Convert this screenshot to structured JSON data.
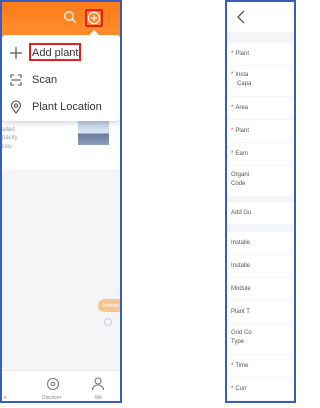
{
  "screen1": {
    "menu": {
      "add_plant": "Add plant",
      "scan": "Scan",
      "plant_location": "Plant Location"
    },
    "card": {
      "line1": "alled",
      "line2": "pacity",
      "line3": "kWp"
    },
    "fab_label": "Monitor",
    "tabs": [
      {
        "label": "e",
        "icon": "home-icon"
      },
      {
        "label": "Discover",
        "icon": "discover-icon"
      },
      {
        "label": "Me",
        "icon": "user-icon"
      }
    ],
    "colors": {
      "header_orange": "#ff7a1a",
      "highlight_red": "#e02020",
      "frame_blue": "#3b5bbd"
    }
  },
  "screen2": {
    "rows": [
      {
        "label": "Plant",
        "required": true
      },
      {
        "label": "Insta",
        "label2": "Capa",
        "required": true
      },
      {
        "label": "Area",
        "required": true
      },
      {
        "label": "Plant",
        "required": true
      },
      {
        "label": "Earn",
        "required": true
      },
      {
        "label": "Organi",
        "label2": "Code",
        "required": false
      },
      {
        "label": "Add Gu",
        "required": false
      },
      {
        "label": "Installe",
        "required": false
      },
      {
        "label": "Installe",
        "required": false
      },
      {
        "label": "Module",
        "required": false
      },
      {
        "label": "Plant T",
        "required": false
      },
      {
        "label": "Grid Co",
        "label2": "Type",
        "required": false
      },
      {
        "label": "Time",
        "required": true
      },
      {
        "label": "Curr",
        "required": true
      }
    ]
  }
}
